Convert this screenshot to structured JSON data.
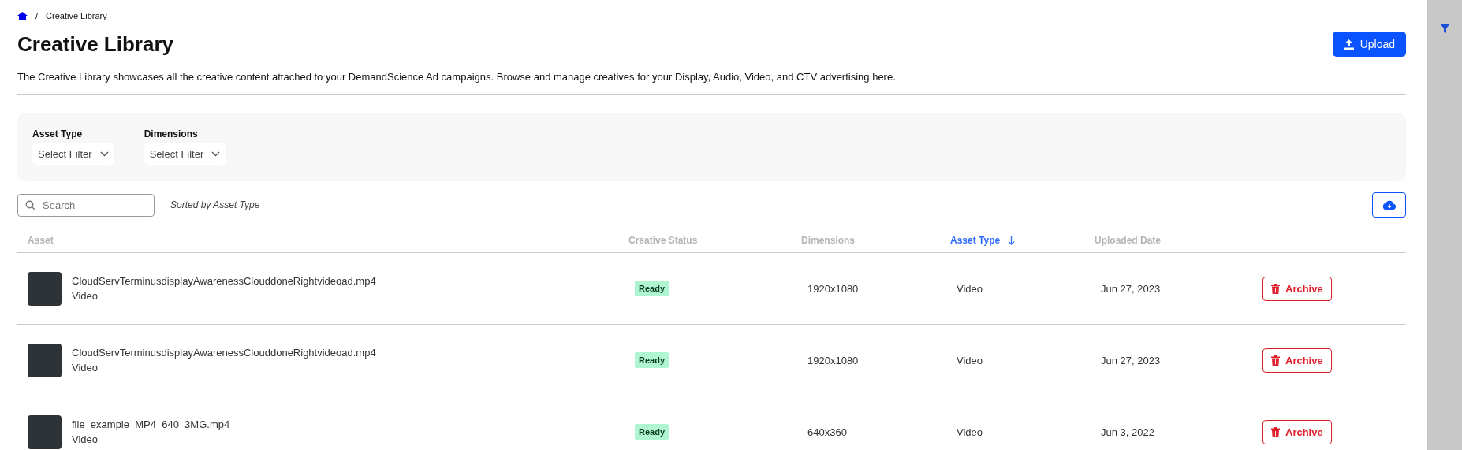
{
  "breadcrumb": {
    "separator": "/",
    "current": "Creative Library"
  },
  "title": "Creative Library",
  "upload_button": "Upload",
  "description": "The Creative Library showcases all the creative content attached to your DemandScience Ad campaigns. Browse and manage creatives for your Display, Audio, Video, and CTV advertising here.",
  "filters": [
    {
      "label": "Asset Type",
      "placeholder": "Select Filter"
    },
    {
      "label": "Dimensions",
      "placeholder": "Select Filter"
    }
  ],
  "search": {
    "placeholder": "Search"
  },
  "sort_note": "Sorted by Asset Type",
  "table": {
    "columns": [
      {
        "label": "Asset",
        "sorted": false
      },
      {
        "label": "Creative Status",
        "sorted": false
      },
      {
        "label": "Dimensions",
        "sorted": false
      },
      {
        "label": "Asset Type",
        "sorted": true
      },
      {
        "label": "Uploaded Date",
        "sorted": false
      }
    ],
    "rows": [
      {
        "name": "CloudServTerminusdisplayAwarenessClouddoneRightvideoad.mp4",
        "type": "Video",
        "status": "Ready",
        "dimensions": "1920x1080",
        "asset_type": "Video",
        "uploaded": "Jun 27, 2023",
        "action": "Archive"
      },
      {
        "name": "CloudServTerminusdisplayAwarenessClouddoneRightvideoad.mp4",
        "type": "Video",
        "status": "Ready",
        "dimensions": "1920x1080",
        "asset_type": "Video",
        "uploaded": "Jun 27, 2023",
        "action": "Archive"
      },
      {
        "name": "file_example_MP4_640_3MG.mp4",
        "type": "Video",
        "status": "Ready",
        "dimensions": "640x360",
        "asset_type": "Video",
        "uploaded": "Jun 3, 2022",
        "action": "Archive"
      }
    ]
  }
}
